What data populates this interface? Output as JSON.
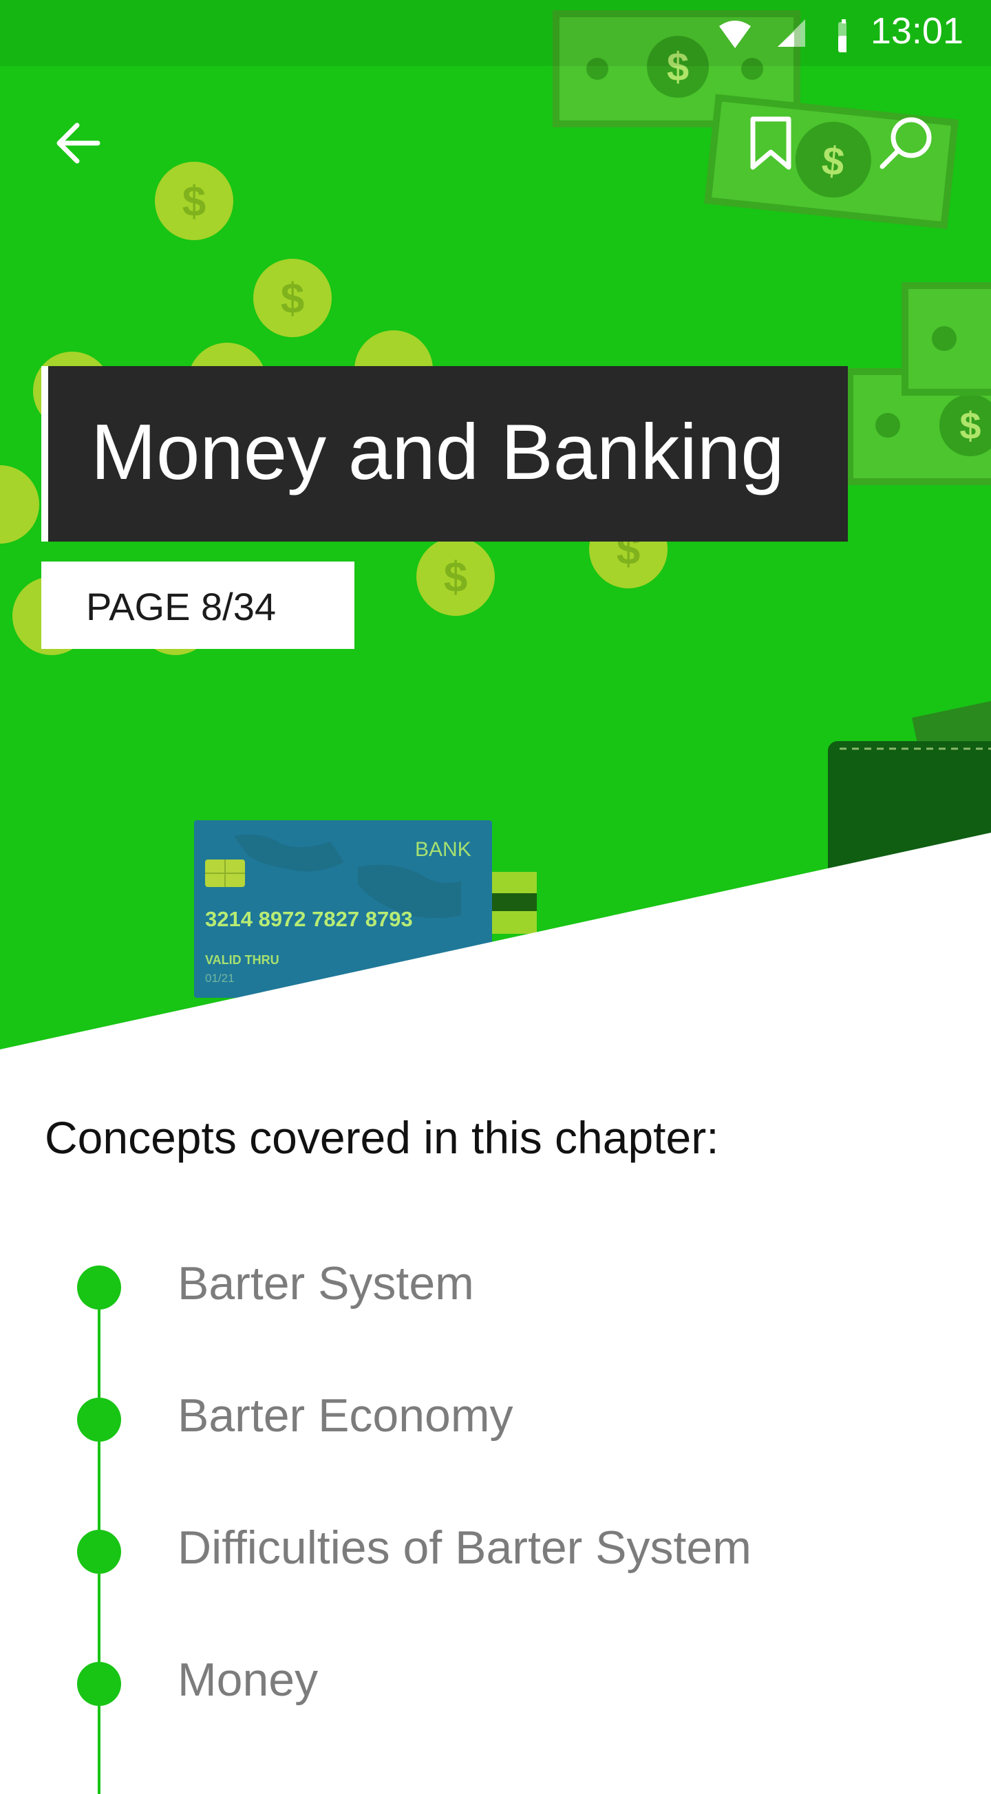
{
  "status_bar": {
    "time": "13:01"
  },
  "toolbar": {
    "back_icon": "arrow-left-icon",
    "bookmark_icon": "bookmark-icon",
    "search_icon": "search-icon"
  },
  "hero": {
    "title": "Money and Banking",
    "page_label": "PAGE 8/34",
    "background_color": "#18c414",
    "title_block_color": "#282828",
    "card": {
      "bank": "BANK",
      "number": "3214 8972 7827 8793",
      "valid_thru_label": "VALID THRU",
      "expiry": "01/21"
    }
  },
  "concepts": {
    "heading": "Concepts covered in this chapter:",
    "accent_color": "#18c414",
    "items": [
      {
        "label": "Barter System"
      },
      {
        "label": "Barter Economy"
      },
      {
        "label": "Difficulties of Barter System"
      },
      {
        "label": "Money"
      }
    ]
  }
}
